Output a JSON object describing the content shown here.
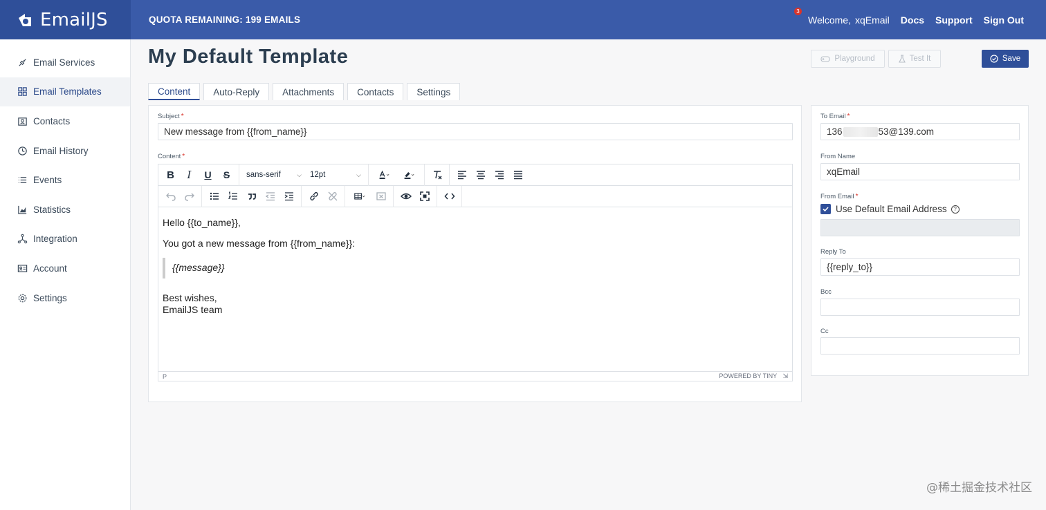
{
  "header": {
    "brand": "EmailJS",
    "quota": "QUOTA REMAINING: 199 EMAILS",
    "notification_count": "3",
    "welcome": "Welcome,",
    "username": "xqEmail",
    "links": [
      "Docs",
      "Support",
      "Sign Out"
    ]
  },
  "sidebar": {
    "items": [
      {
        "label": "Email Services",
        "icon": "plug-icon"
      },
      {
        "label": "Email Templates",
        "icon": "templates-icon",
        "active": true
      },
      {
        "label": "Contacts",
        "icon": "contacts-icon"
      },
      {
        "label": "Email History",
        "icon": "history-icon"
      },
      {
        "label": "Events",
        "icon": "list-icon"
      },
      {
        "label": "Statistics",
        "icon": "chart-icon"
      },
      {
        "label": "Integration",
        "icon": "integration-icon"
      },
      {
        "label": "Account",
        "icon": "account-icon"
      },
      {
        "label": "Settings",
        "icon": "gear-icon"
      }
    ]
  },
  "page": {
    "title": "My Default Template",
    "buttons": {
      "playground": "Playground",
      "test": "Test It",
      "save": "Save"
    },
    "tabs": [
      "Content",
      "Auto-Reply",
      "Attachments",
      "Contacts",
      "Settings"
    ]
  },
  "editor": {
    "subject_label": "Subject",
    "subject_value": "New message from {{from_name}}",
    "content_label": "Content",
    "font_family": "sans-serif",
    "font_size": "12pt",
    "body": {
      "greeting": "Hello {{to_name}},",
      "line1": "You got a new message from {{from_name}}:",
      "quote": "{{message}}",
      "closing1": "Best wishes,",
      "closing2": "EmailJS team"
    },
    "status_path": "P",
    "powered_by": "POWERED BY TINY"
  },
  "settings_panel": {
    "to_email_label": "To Email",
    "to_email_prefix": "136",
    "to_email_suffix": "53@139.com",
    "from_name_label": "From Name",
    "from_name_value": "xqEmail",
    "from_email_label": "From Email",
    "use_default_label": "Use Default Email Address",
    "use_default_checked": true,
    "from_email_value": "",
    "reply_to_label": "Reply To",
    "reply_to_value": "{{reply_to}}",
    "bcc_label": "Bcc",
    "bcc_value": "",
    "cc_label": "Cc",
    "cc_value": ""
  },
  "watermark": "@稀土掘金技术社区",
  "colors": {
    "primary": "#2f4f99",
    "topbar": "#3a5ba9",
    "required": "#d9342b"
  }
}
